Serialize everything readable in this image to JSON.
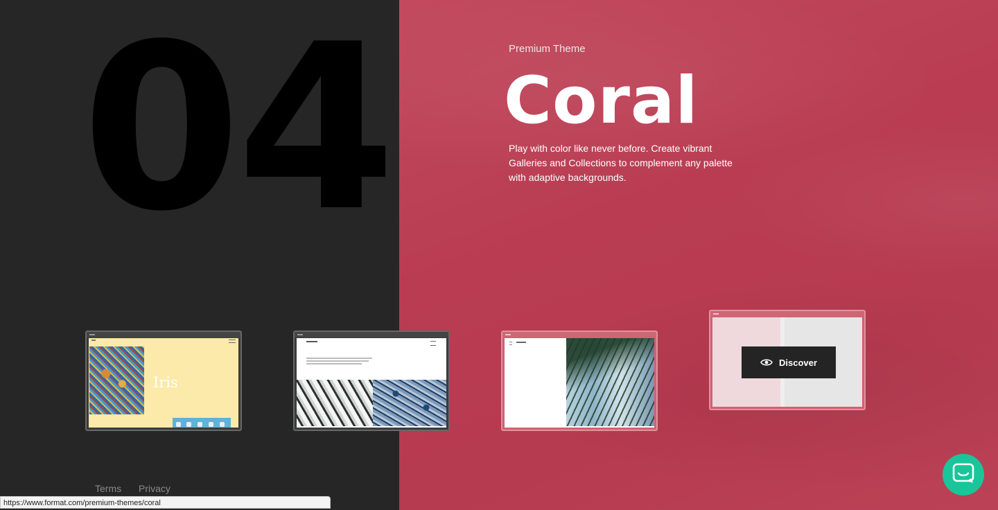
{
  "hero": {
    "number": "04",
    "eyebrow": "Premium Theme",
    "title": "Coral",
    "description": "Play with color like never before. Create vibrant Galleries and Collections to complement any palette with adaptive backgrounds."
  },
  "thumbnails": {
    "iris": {
      "name": "Iris"
    },
    "discover_label": "Discover"
  },
  "footer": {
    "terms": "Terms",
    "privacy": "Privacy"
  },
  "status_bar": {
    "url": "https://www.format.com/premium-themes/coral"
  },
  "colors": {
    "dark_bg": "#262626",
    "coral_bg": "#b93c52",
    "chat": "#1ac59a",
    "button_dark": "#242424"
  },
  "icons": {
    "discover": "eye-icon",
    "chat": "chat-icon"
  }
}
